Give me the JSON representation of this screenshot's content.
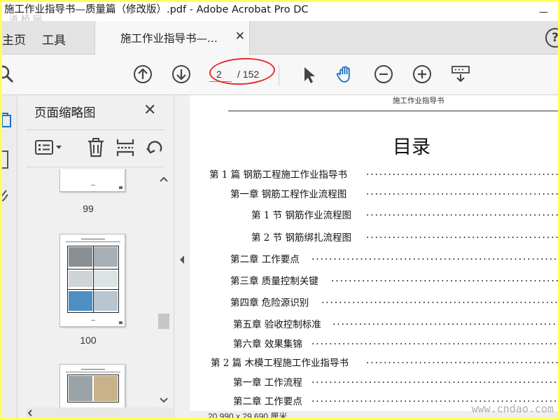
{
  "window": {
    "title": "施工作业指导书—质量篇（修改版）.pdf - Adobe Acrobat Pro DC",
    "minimize": "—",
    "watermark_top": "道桥网",
    "watermark_bottom": "www.cndao.com"
  },
  "tabs": {
    "home": "主页",
    "tools": "工具",
    "document": "施工作业指导书—...",
    "close": "✕",
    "help": "?"
  },
  "toolbar": {
    "current_page": "2",
    "total_pages": "/ 152"
  },
  "panel": {
    "title": "页面缩略图",
    "close": "✕",
    "thumbnails": [
      {
        "number": "99"
      },
      {
        "number": "100"
      }
    ]
  },
  "document": {
    "header": "施工作业指导书",
    "title": "目录",
    "toc": [
      {
        "text": "第 1 篇  钢筋工程施工作业指导书"
      },
      {
        "text": "第一章  钢筋工程作业流程图"
      },
      {
        "text": "第 1 节  钢筋作业流程图"
      },
      {
        "text": "第 2 节  钢筋绑扎流程图"
      },
      {
        "text": "第二章  工作要点"
      },
      {
        "text": "第三章  质量控制关键"
      },
      {
        "text": "第四章  危险源识别"
      },
      {
        "text": "第五章  验收控制标准"
      },
      {
        "text": "第六章  效果集锦"
      },
      {
        "text": "第 2 篇  木模工程施工作业指导书"
      },
      {
        "text": "第一章  工作流程"
      },
      {
        "text": "第二章  工作要点"
      }
    ]
  },
  "status": {
    "page_size": "20.990 x 29.690 厘米"
  },
  "colors": {
    "frame_border": "#ffff5e",
    "annotation_red": "#e42d2d",
    "hand_tool_blue": "#1a73c9"
  }
}
